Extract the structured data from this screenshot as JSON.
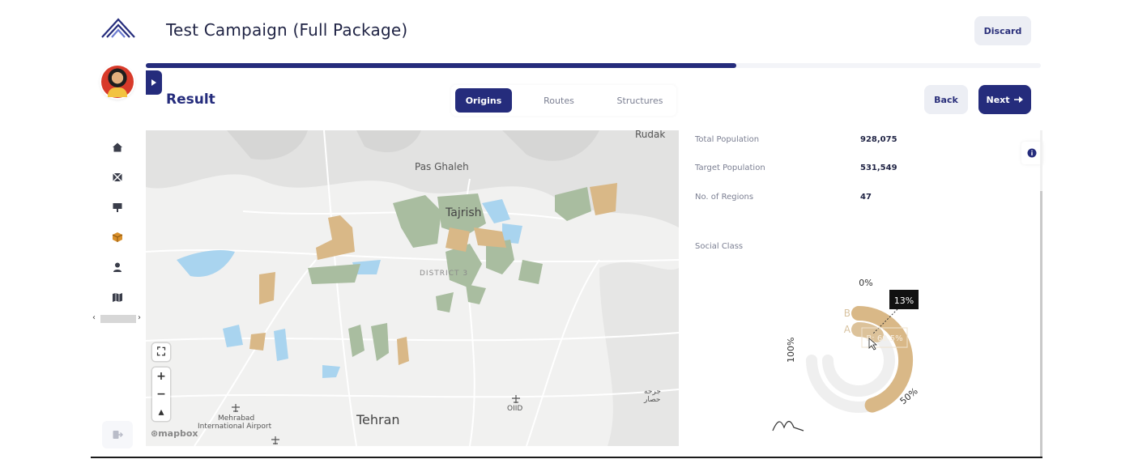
{
  "header": {
    "title": "Test Campaign (Full Package)",
    "discard_label": "Discard"
  },
  "progress": {
    "fraction": 0.66
  },
  "section": {
    "title": "Result"
  },
  "tabs": [
    {
      "label": "Origins",
      "active": true
    },
    {
      "label": "Routes",
      "active": false
    },
    {
      "label": "Structures",
      "active": false
    }
  ],
  "nav": {
    "back_label": "Back",
    "next_label": "Next"
  },
  "sidebar": {
    "items": [
      {
        "icon": "home-icon"
      },
      {
        "icon": "map-off-icon"
      },
      {
        "icon": "billboard-icon"
      },
      {
        "icon": "package-icon"
      },
      {
        "icon": "user-icon"
      },
      {
        "icon": "map-icon"
      }
    ],
    "logout_icon": "logout-icon"
  },
  "map": {
    "labels": {
      "rudak": "Rudak",
      "pas_ghaleh": "Pas Ghaleh",
      "tajrish": "Tajrish",
      "district": "DISTRICT 3",
      "tehran": "Tehran",
      "airport_line1": "Mehrabad",
      "airport_line2": "International Airport",
      "oiid": "OIID",
      "persian": "جرحه حصار",
      "attribution": "mapbox"
    }
  },
  "stats": {
    "total_population_label": "Total Population",
    "total_population_value": "928,075",
    "target_population_label": "Target Population",
    "target_population_value": "531,549",
    "regions_label": "No. of Regions",
    "regions_value": "47",
    "social_class_label": "Social Class"
  },
  "colors": {
    "primary": "#252c7c",
    "tan": "#d9b887",
    "green": "#a9bda0",
    "blue": "#a9d4ef"
  },
  "chart_data": {
    "type": "pie",
    "title": "Social Class",
    "categories": [
      "A",
      "B"
    ],
    "values": [
      13,
      60.5
    ],
    "axis_labels": [
      "0%",
      "50%",
      "100%"
    ],
    "tooltip": "13%",
    "hover_label": "B: 60.5%"
  }
}
